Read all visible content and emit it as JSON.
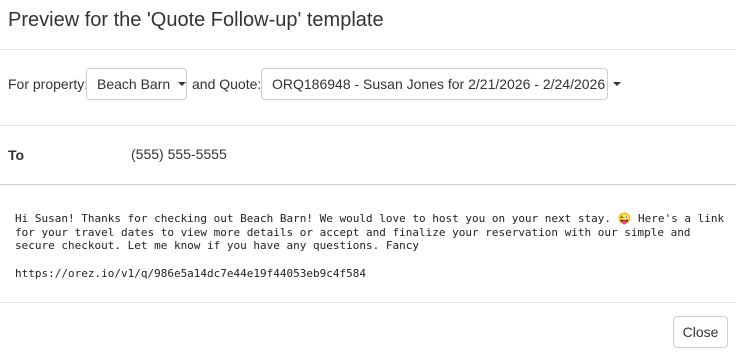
{
  "modal": {
    "title": "Preview for the 'Quote Follow-up' template"
  },
  "selectors": {
    "property_label": "For property:",
    "property_value": "Beach Barn",
    "quote_label": "and Quote:",
    "quote_value": "ORQ186948 - Susan Jones for 2/21/2026 - 2/24/2026"
  },
  "recipient": {
    "label": "To",
    "value": "(555) 555-5555"
  },
  "message": {
    "body": "Hi Susan! Thanks for checking out Beach Barn! We would love to host you on your next stay. 😜 Here's a link for your travel dates to view more details or accept and finalize your reservation with our simple and secure checkout. Let me know if you have any questions. Fancy",
    "link": "https://orez.io/v1/q/986e5a14dc7e44e19f44053eb9c4f584"
  },
  "footer": {
    "close_label": "Close"
  },
  "icons": {
    "dropdown_caret": "chevron-down-icon"
  }
}
